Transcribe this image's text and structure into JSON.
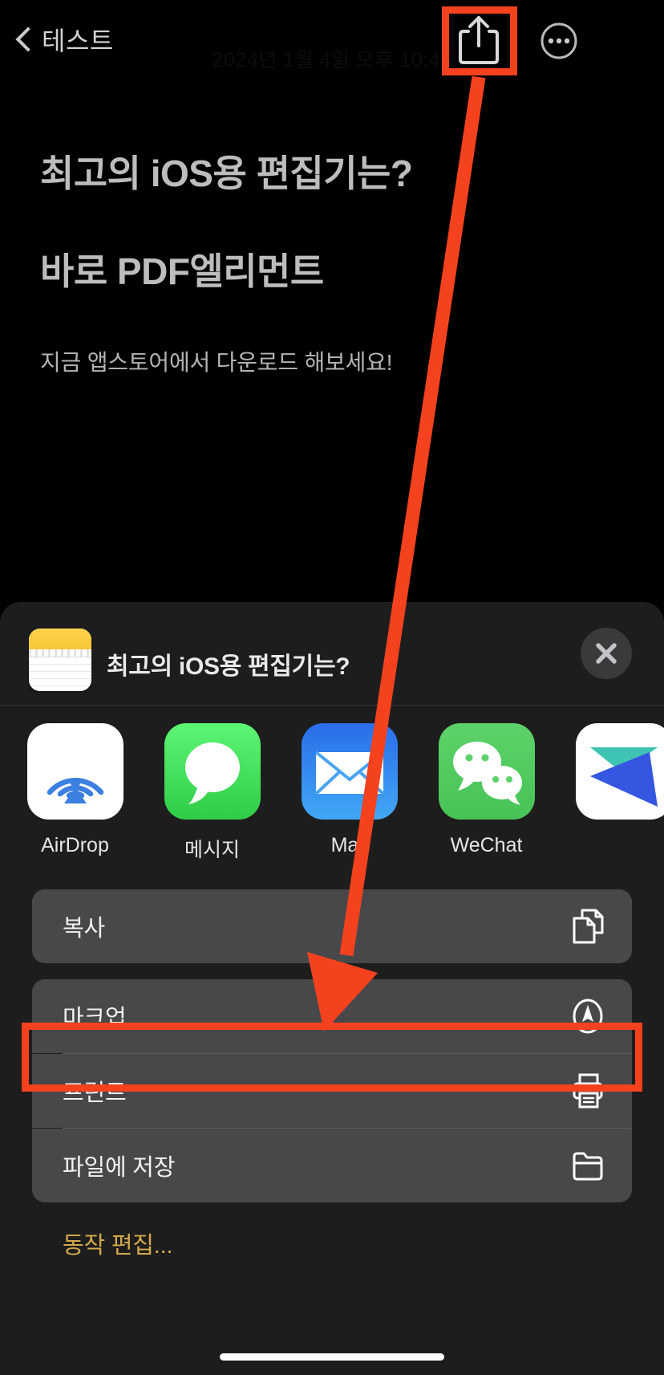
{
  "navbar": {
    "back_label": "테스트",
    "back_icon": "chevron-left-icon",
    "date_watermark": "2024년 1월 4일 오후 10:45",
    "share_icon": "share-icon",
    "more_icon": "ellipsis-circle-icon"
  },
  "note": {
    "heading1": "최고의 iOS용 편집기는?",
    "heading2": "바로 PDF엘리먼트",
    "paragraph": "지금 앱스토어에서 다운로드 해보세요!"
  },
  "share_sheet": {
    "doc_icon": "notes-app-icon",
    "title": "최고의 iOS용 편집기는?",
    "close_icon": "close-icon",
    "apps": [
      {
        "label": "AirDrop",
        "icon": "airdrop-icon"
      },
      {
        "label": "메시지",
        "icon": "messages-icon"
      },
      {
        "label": "Mail",
        "icon": "mail-icon"
      },
      {
        "label": "WeChat",
        "icon": "wechat-icon"
      },
      {
        "label": "",
        "icon": "partial-app-icon"
      }
    ],
    "actions": [
      {
        "label": "복사",
        "icon": "copy-icon"
      },
      {
        "label": "마크업",
        "icon": "markup-pen-icon"
      },
      {
        "label": "프린트",
        "icon": "printer-icon"
      },
      {
        "label": "파일에 저장",
        "icon": "folder-icon"
      }
    ],
    "edit_actions_label": "동작 편집..."
  },
  "annotations": {
    "highlight_color": "#f4421f",
    "share_button_box": "share-button-highlight",
    "print_row_box": "print-row-highlight",
    "arrow": "pointer-arrow"
  }
}
